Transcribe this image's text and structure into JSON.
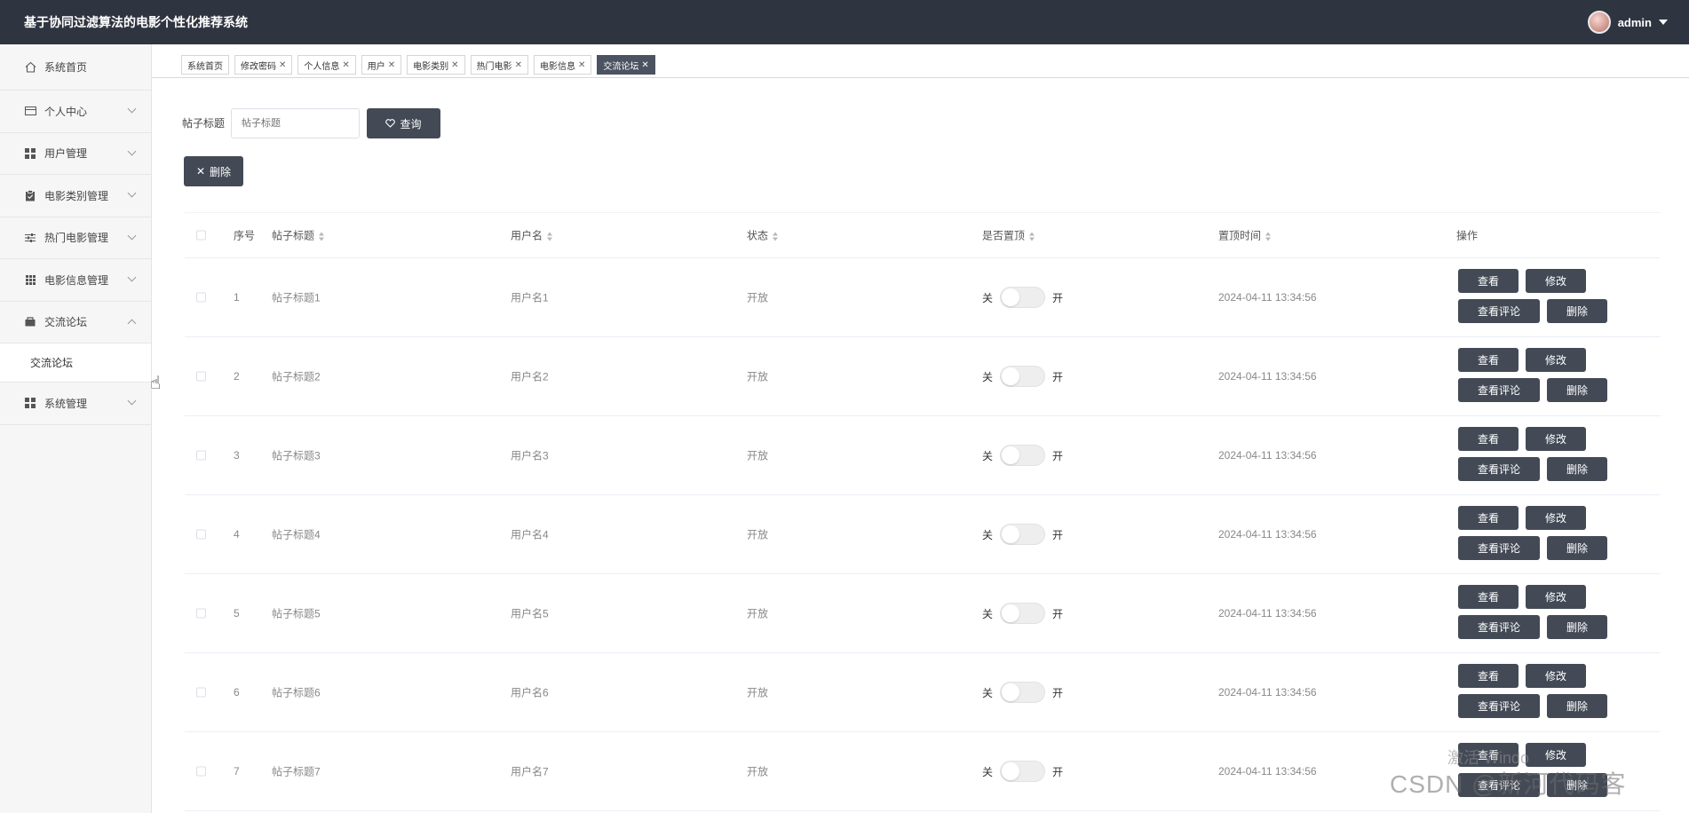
{
  "header": {
    "title": "基于协同过滤算法的电影个性化推荐系统",
    "username": "admin"
  },
  "sidebar": {
    "items": [
      {
        "label": "系统首页",
        "icon": "home-icon"
      },
      {
        "label": "个人中心",
        "icon": "card-icon"
      },
      {
        "label": "用户管理",
        "icon": "grid-icon"
      },
      {
        "label": "电影类别管理",
        "icon": "clipboard-icon"
      },
      {
        "label": "热门电影管理",
        "icon": "sliders-icon"
      },
      {
        "label": "电影信息管理",
        "icon": "grid9-icon"
      },
      {
        "label": "交流论坛",
        "icon": "folder-icon"
      },
      {
        "label": "系统管理",
        "icon": "grid-icon"
      }
    ],
    "subitem": "交流论坛"
  },
  "tabs": [
    {
      "label": "系统首页",
      "closable": false
    },
    {
      "label": "修改密码",
      "closable": true
    },
    {
      "label": "个人信息",
      "closable": true
    },
    {
      "label": "用户",
      "closable": true
    },
    {
      "label": "电影类别",
      "closable": true
    },
    {
      "label": "热门电影",
      "closable": true
    },
    {
      "label": "电影信息",
      "closable": true
    },
    {
      "label": "交流论坛",
      "closable": true,
      "active": true
    }
  ],
  "search": {
    "label": "帖子标题",
    "placeholder": "帖子标题",
    "button": "查询"
  },
  "delete_button": "删除",
  "table": {
    "columns": [
      "序号",
      "帖子标题",
      "用户名",
      "状态",
      "是否置顶",
      "置顶时间",
      "操作"
    ],
    "switch_off": "关",
    "switch_on": "开",
    "actions": {
      "view": "查看",
      "edit": "修改",
      "comments": "查看评论",
      "delete": "删除"
    },
    "rows": [
      {
        "idx": "1",
        "title": "帖子标题1",
        "user": "用户名1",
        "status": "开放",
        "time": "2024-04-11 13:34:56"
      },
      {
        "idx": "2",
        "title": "帖子标题2",
        "user": "用户名2",
        "status": "开放",
        "time": "2024-04-11 13:34:56"
      },
      {
        "idx": "3",
        "title": "帖子标题3",
        "user": "用户名3",
        "status": "开放",
        "time": "2024-04-11 13:34:56"
      },
      {
        "idx": "4",
        "title": "帖子标题4",
        "user": "用户名4",
        "status": "开放",
        "time": "2024-04-11 13:34:56"
      },
      {
        "idx": "5",
        "title": "帖子标题5",
        "user": "用户名5",
        "status": "开放",
        "time": "2024-04-11 13:34:56"
      },
      {
        "idx": "6",
        "title": "帖子标题6",
        "user": "用户名6",
        "status": "开放",
        "time": "2024-04-11 13:34:56"
      },
      {
        "idx": "7",
        "title": "帖子标题7",
        "user": "用户名7",
        "status": "开放",
        "time": "2024-04-11 13:34:56"
      }
    ]
  },
  "watermark": {
    "activate": "激活 Windo",
    "csdn": "CSDN @新河代码客"
  }
}
